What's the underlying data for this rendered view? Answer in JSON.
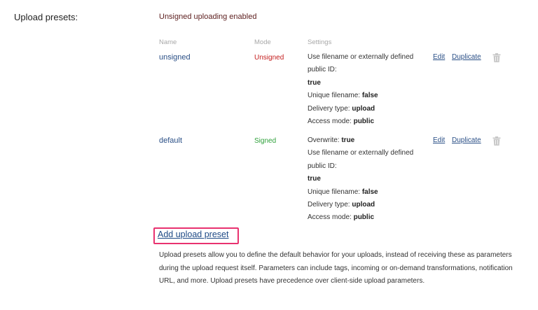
{
  "section": {
    "label": "Upload presets:"
  },
  "status": "Unsigned uploading enabled",
  "columns": {
    "name": "Name",
    "mode": "Mode",
    "settings": "Settings"
  },
  "presets": [
    {
      "name": "unsigned",
      "mode": "Unsigned",
      "settings": [
        {
          "text": "Use filename or externally defined"
        },
        {
          "text": "public ID:"
        },
        {
          "value": "true"
        },
        {
          "label": "Unique filename: ",
          "value": "false"
        },
        {
          "label": "Delivery type: ",
          "value": "upload"
        },
        {
          "label": "Access mode: ",
          "value": "public"
        }
      ],
      "edit_label": "Edit",
      "duplicate_label": "Duplicate",
      "delete_icon": "trash-icon"
    },
    {
      "name": "default",
      "mode": "Signed",
      "settings": [
        {
          "label": "Overwrite: ",
          "value": "true"
        },
        {
          "text": "Use filename or externally defined"
        },
        {
          "text": "public ID:"
        },
        {
          "value": "true"
        },
        {
          "label": "Unique filename: ",
          "value": "false"
        },
        {
          "label": "Delivery type: ",
          "value": "upload"
        },
        {
          "label": "Access mode: ",
          "value": "public"
        }
      ],
      "edit_label": "Edit",
      "duplicate_label": "Duplicate",
      "delete_icon": "trash-icon"
    }
  ],
  "add_preset_label": "Add upload preset",
  "description": "Upload presets allow you to define the default behavior for your uploads, instead of receiving these as parameters during the upload request itself. Parameters can include tags, incoming or on-demand transformations, notification URL, and more. Upload presets have precedence over client-side upload parameters.",
  "colors": {
    "unsigned": "#c41e1e",
    "signed": "#2ea03a",
    "link": "#2a4f86",
    "highlight": "#e8326f"
  }
}
